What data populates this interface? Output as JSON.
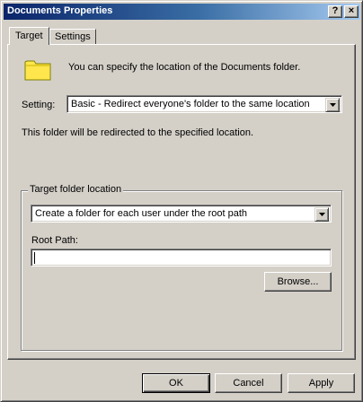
{
  "window": {
    "title": "Documents Properties",
    "help_glyph": "?",
    "close_glyph": "×"
  },
  "tabs": [
    {
      "label": "Target",
      "active": true
    },
    {
      "label": "Settings",
      "active": false
    }
  ],
  "target": {
    "intro": "You can specify the location of the Documents folder.",
    "setting_label": "Setting:",
    "setting_value": "Basic - Redirect everyone's folder to the same location",
    "redirect_note": "This folder will be redirected to the specified location.",
    "group_label": "Target folder location",
    "location_option": "Create a folder for each user under the root path",
    "root_path_label": "Root Path:",
    "root_path_value": "",
    "browse_label": "Browse..."
  },
  "footer": {
    "ok_label": "OK",
    "cancel_label": "Cancel",
    "apply_label": "Apply"
  },
  "colors": {
    "face": "#d4d0c8",
    "title_start": "#0a246a",
    "title_end": "#a6caf0",
    "folder": "#ffe64d"
  },
  "icons": {
    "folder": "folder-icon",
    "dropdown": "chevron-down-icon"
  }
}
